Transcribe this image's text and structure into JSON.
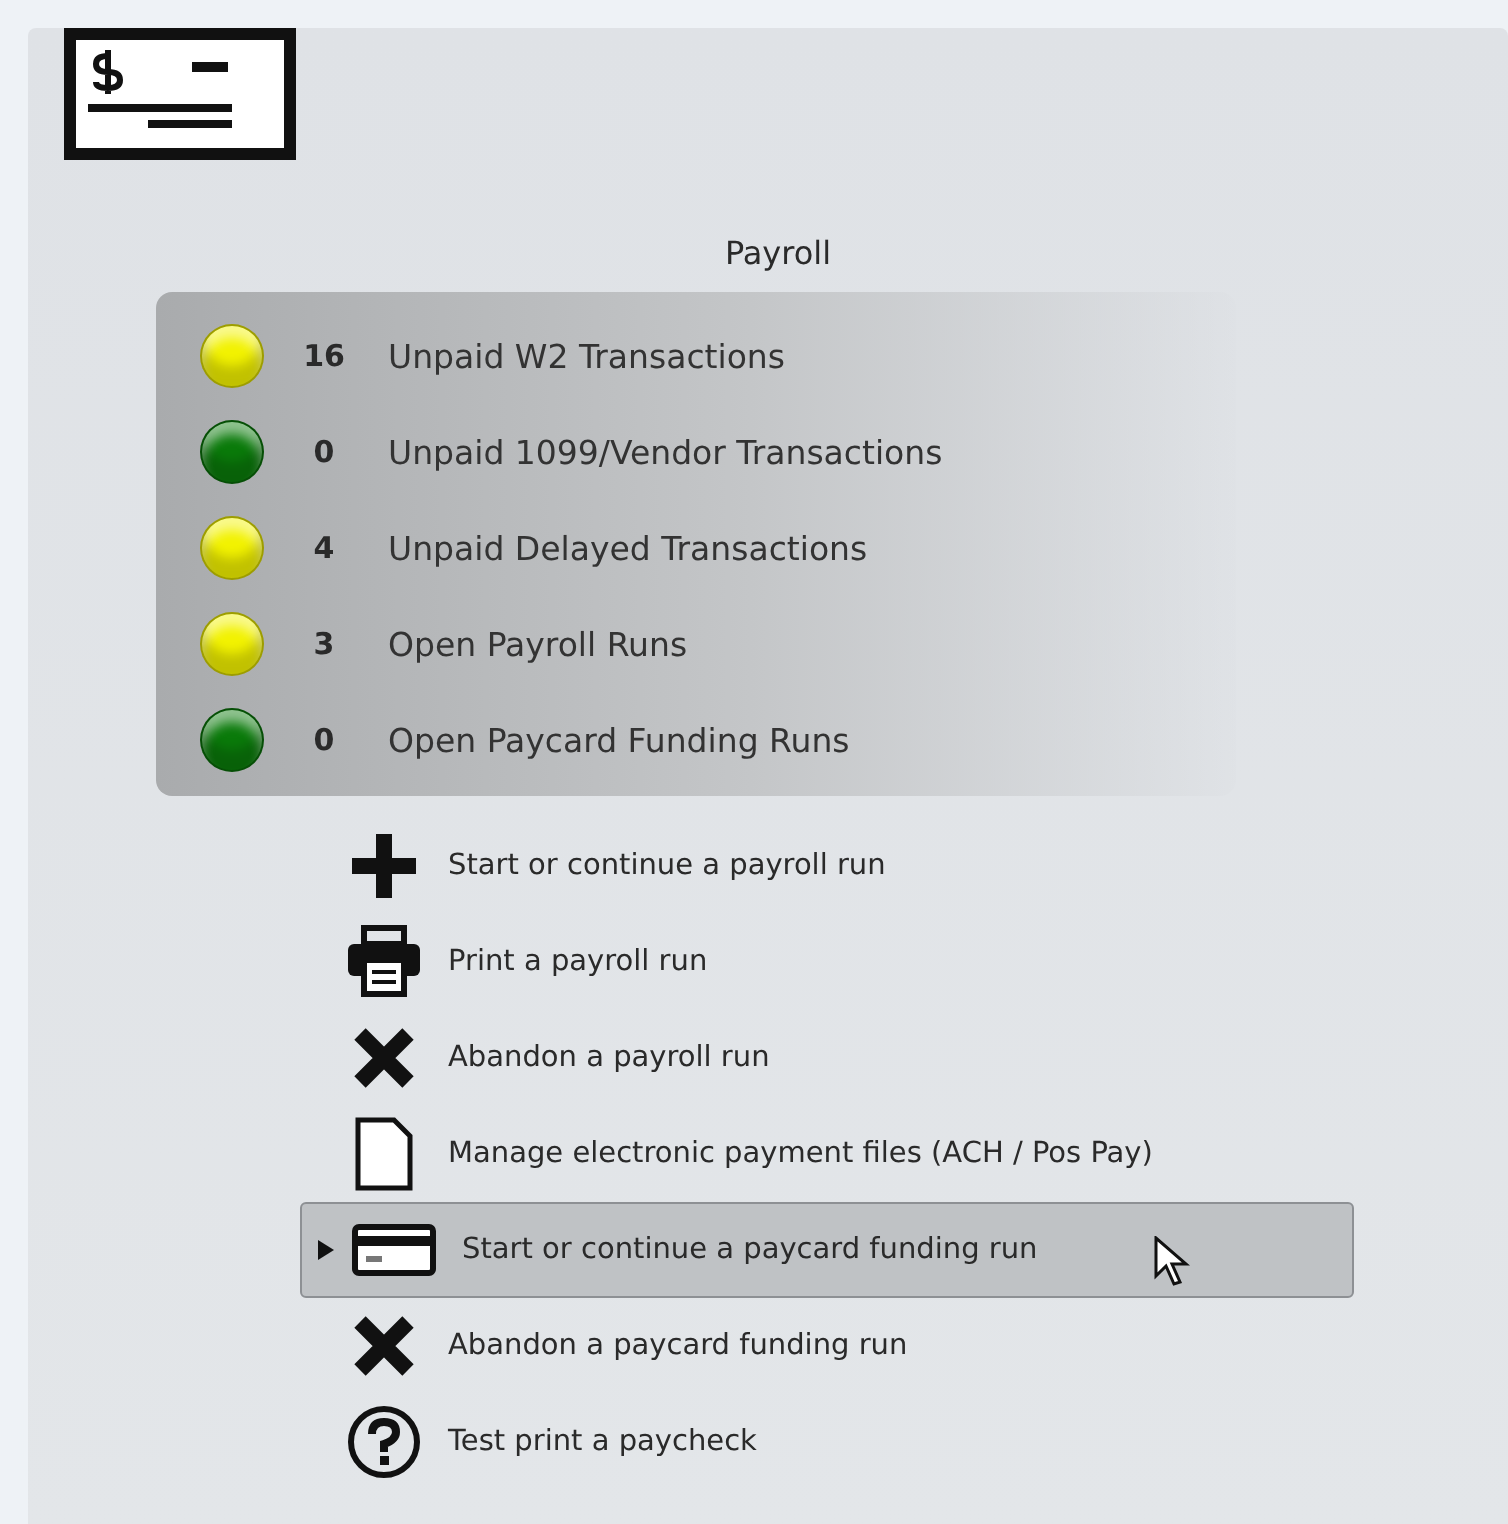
{
  "title": "Payroll",
  "statuses": [
    {
      "color": "#f2f200",
      "count": "16",
      "label": "Unpaid W2 Transactions"
    },
    {
      "color": "#0a7a0a",
      "count": "0",
      "label": "Unpaid 1099/Vendor Transactions"
    },
    {
      "color": "#f2f200",
      "count": "4",
      "label": "Unpaid Delayed Transactions"
    },
    {
      "color": "#f2f200",
      "count": "3",
      "label": "Open Payroll Runs"
    },
    {
      "color": "#0a7a0a",
      "count": "0",
      "label": "Open Paycard Funding Runs"
    }
  ],
  "actions": [
    {
      "kind": "plus",
      "label": "Start or continue a payroll run",
      "selected": false
    },
    {
      "kind": "printer",
      "label": "Print a payroll run",
      "selected": false
    },
    {
      "kind": "cross",
      "label": "Abandon a payroll run",
      "selected": false
    },
    {
      "kind": "file",
      "label": "Manage electronic payment files (ACH / Pos Pay)",
      "selected": false
    },
    {
      "kind": "card",
      "label": "Start or continue a paycard funding run",
      "selected": true
    },
    {
      "kind": "cross",
      "label": "Abandon a paycard funding run",
      "selected": false
    },
    {
      "kind": "question",
      "label": "Test print a paycheck",
      "selected": false
    }
  ]
}
